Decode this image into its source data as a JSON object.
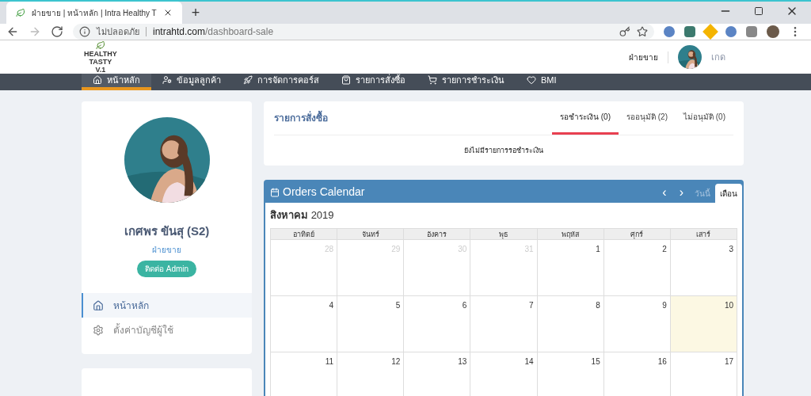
{
  "browser": {
    "tab_title": "ฝ่ายขาย | หน้าหลัก | Intra Healthy T",
    "new_tab": "+",
    "security": "ไม่ปลอดภัย",
    "url_host": "intrahtd.com",
    "url_path": "/dashboard-sale"
  },
  "header": {
    "logo_lines": [
      "HEALTHY",
      "TASTY",
      "V.1"
    ],
    "role": "ฝ่ายขาย",
    "user": "เกด"
  },
  "nav": [
    {
      "label": "หน้าหลัก",
      "kind": "home",
      "selected": true
    },
    {
      "label": "ข้อมูลลูกค้า",
      "kind": "customer",
      "selected": false
    },
    {
      "label": "การจัดการคอร์ส",
      "kind": "course",
      "selected": false
    },
    {
      "label": "รายการสั่งซื้อ",
      "kind": "order",
      "selected": false
    },
    {
      "label": "รายการชำระเงิน",
      "kind": "payment",
      "selected": false
    },
    {
      "label": "BMI",
      "kind": "bmi",
      "selected": false
    }
  ],
  "profile": {
    "name": "เกศพร ขันสุ (S2)",
    "role": "ฝ่ายขาย",
    "contact_button": "ติดต่อ Admin"
  },
  "side_menu": [
    {
      "label": "หน้าหลัก",
      "kind": "home",
      "selected": true
    },
    {
      "label": "ตั้งค่าบัญชีผู้ใช้",
      "kind": "settings",
      "selected": false
    }
  ],
  "orders": {
    "title": "รายการสั่งซื้อ",
    "tabs": [
      {
        "label": "รอชำระเงิน (0)",
        "selected": true
      },
      {
        "label": "รออนุมัติ (2)",
        "selected": false
      },
      {
        "label": "ไม่อนุมัติ (0)",
        "selected": false
      }
    ],
    "empty_message": "ยังไม่มีรายการรอชำระเงิน"
  },
  "calendar": {
    "title": "Orders Calendar",
    "prev": "‹",
    "next": "›",
    "views": [
      {
        "label": "วันนี้",
        "selected": false
      },
      {
        "label": "เดือน",
        "selected": true
      }
    ],
    "month": "สิงหาคม",
    "year": "2019",
    "weekdays": [
      "อาทิตย์",
      "จันทร์",
      "อังคาร",
      "พุธ",
      "พฤหัส",
      "ศุกร์",
      "เสาร์"
    ],
    "weeks": [
      [
        {
          "day": "28",
          "other_month": true,
          "today": false
        },
        {
          "day": "29",
          "other_month": true,
          "today": false
        },
        {
          "day": "30",
          "other_month": true,
          "today": false
        },
        {
          "day": "31",
          "other_month": true,
          "today": false
        },
        {
          "day": "1",
          "other_month": false,
          "today": false
        },
        {
          "day": "2",
          "other_month": false,
          "today": false
        },
        {
          "day": "3",
          "other_month": false,
          "today": false
        }
      ],
      [
        {
          "day": "4",
          "other_month": false,
          "today": false
        },
        {
          "day": "5",
          "other_month": false,
          "today": false
        },
        {
          "day": "6",
          "other_month": false,
          "today": false
        },
        {
          "day": "7",
          "other_month": false,
          "today": false
        },
        {
          "day": "8",
          "other_month": false,
          "today": false
        },
        {
          "day": "9",
          "other_month": false,
          "today": false
        },
        {
          "day": "10",
          "other_month": false,
          "today": true
        }
      ],
      [
        {
          "day": "11",
          "other_month": false,
          "today": false
        },
        {
          "day": "12",
          "other_month": false,
          "today": false
        },
        {
          "day": "13",
          "other_month": false,
          "today": false
        },
        {
          "day": "14",
          "other_month": false,
          "today": false
        },
        {
          "day": "15",
          "other_month": false,
          "today": false
        },
        {
          "day": "16",
          "other_month": false,
          "today": false
        },
        {
          "day": "17",
          "other_month": false,
          "today": false
        }
      ]
    ]
  }
}
